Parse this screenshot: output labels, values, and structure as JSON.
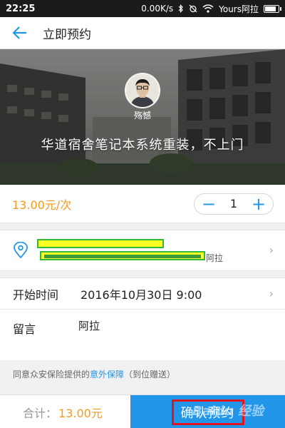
{
  "status_bar": {
    "time": "22:25",
    "speed": "0.00K/s",
    "carrier": "Yours阿拉",
    "battery_level": 0.9
  },
  "nav": {
    "title": "立即预约",
    "back_icon": "back-arrow-icon"
  },
  "banner": {
    "host_name": "殇憾",
    "service_title": "华道宿舍笔记本系统重装，不上门"
  },
  "order": {
    "price": "13.00元/次",
    "quantity": "1",
    "decrement_label": "−",
    "increment_label": "+"
  },
  "address": {
    "contact_name": "阿拉"
  },
  "details": {
    "start_time_label": "开始时间",
    "start_time_value": "2016年10月30日 9:00",
    "message_label": "留言",
    "message_value": "阿拉"
  },
  "insurance": {
    "prefix": "同意众安保险提供的",
    "link": "意外保障",
    "suffix": "（到位赠送）"
  },
  "footer": {
    "total_label": "合计：",
    "total_amount": "13.00元",
    "confirm_label": "确认预约"
  },
  "colors": {
    "accent": "#2196e8",
    "price": "#f39a1f",
    "highlight_box": "#e0141f"
  }
}
